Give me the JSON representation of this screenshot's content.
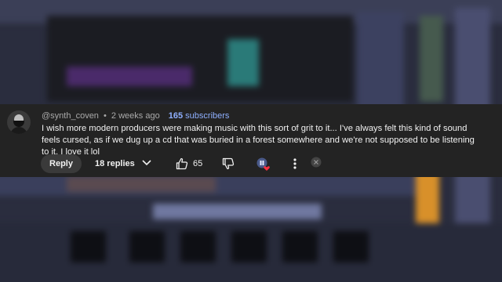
{
  "comment": {
    "username": "@synth_coven",
    "separator": "•",
    "time_ago": "2 weeks ago",
    "subscriber_count": "165",
    "subscriber_label": "subscribers",
    "text": "I wish more modern producers were making music with this sort of grit to it... I've always felt this kind of sound feels cursed, as if we dug up a cd that was buried in a forest somewhere and we're not supposed to be listening to it. I love it lol"
  },
  "actions": {
    "reply_label": "Reply",
    "replies_label": "18 replies",
    "like_count": "65"
  },
  "icons": [
    "avatar",
    "chevron-down-icon",
    "thumbs-up-icon",
    "thumbs-down-icon",
    "creator-heart-icon",
    "more-options-icon",
    "hide-icon"
  ],
  "colors": {
    "card_bg": "#232323",
    "text": "#f1f1f1",
    "meta": "#aaaaaa",
    "subscriber_accent": "#8fb0ff",
    "heart": "#ff3040"
  }
}
